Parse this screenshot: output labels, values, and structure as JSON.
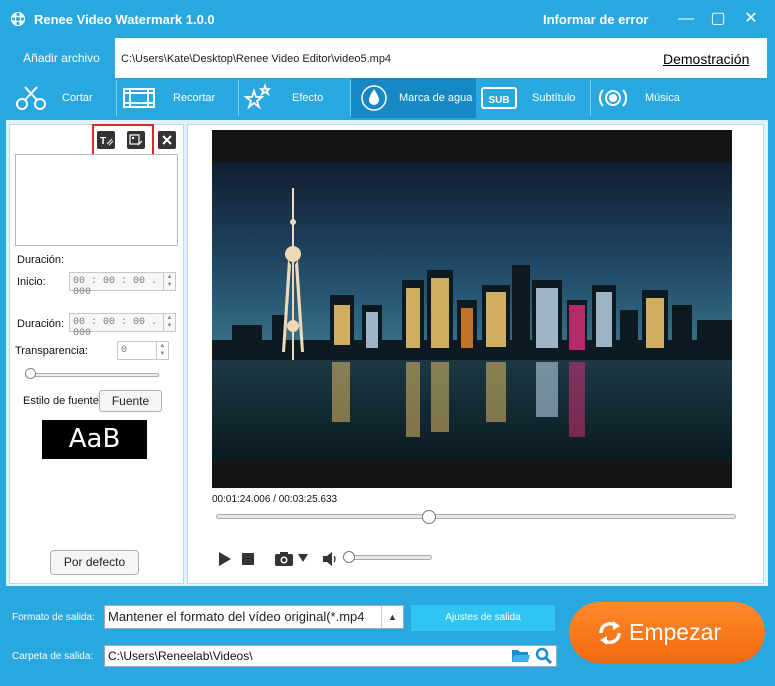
{
  "window": {
    "title": "Renee Video Watermark 1.0.0",
    "report_error": "Informar de error",
    "minimize": "—",
    "maximize": "▢",
    "close": "✕"
  },
  "file_bar": {
    "add_file": "Añadir archivo",
    "path": "C:\\Users\\Kate\\Desktop\\Renee Video Editor\\video5.mp4",
    "demo": "Demostración"
  },
  "toolbar": {
    "active": "watermark",
    "items": [
      {
        "id": "cut",
        "label": "Cortar",
        "icon": "scissors-icon"
      },
      {
        "id": "crop",
        "label": "Recortar",
        "icon": "crop-icon"
      },
      {
        "id": "effect",
        "label": "Efecto",
        "icon": "stars-icon"
      },
      {
        "id": "watermark",
        "label": "Marca de agua",
        "icon": "droplet-icon"
      },
      {
        "id": "subtitle",
        "label": "Subtítulo",
        "icon": "subtitle-icon"
      },
      {
        "id": "music",
        "label": "Música",
        "icon": "music-icon"
      }
    ]
  },
  "left_panel": {
    "add_text_icon": "text-watermark-icon",
    "add_image_icon": "image-watermark-icon",
    "remove_icon": "close-icon",
    "duration_heading": "Duración:",
    "start_label": "Inicio:",
    "start_value": "00 : 00 : 00 . 000",
    "duration_label": "Duración:",
    "duration_value": "00 : 00 : 00 . 000",
    "transparency_label": "Transparencia:",
    "transparency_value": "0",
    "transparency_level": 0,
    "font_style_label": "Estilo de fuente",
    "font_button": "Fuente",
    "font_preview": "AaB",
    "default_button": "Por defecto"
  },
  "player": {
    "current_time": "00:01:24.006",
    "total_time": "00:03:25.633",
    "time_separator": " / ",
    "progress": 0.409,
    "volume": 0.0,
    "play_icon": "play-icon",
    "stop_icon": "stop-icon",
    "camera_icon": "camera-icon",
    "volume_icon": "volume-icon"
  },
  "bottom": {
    "format_label": "Formato de salida:",
    "format_value": "Mantener el formato del vídeo original(*.mp4",
    "output_settings": "Ajustes de salida",
    "folder_label": "Carpeta de salida:",
    "folder_value": "C:\\Users\\Reneelab\\Videos\\",
    "start_button": "Empezar"
  },
  "colors": {
    "brand_blue": "#29a8e0",
    "active_tab": "#1688c4",
    "start_orange": "#f47a1f",
    "highlight_red": "#e02727"
  }
}
